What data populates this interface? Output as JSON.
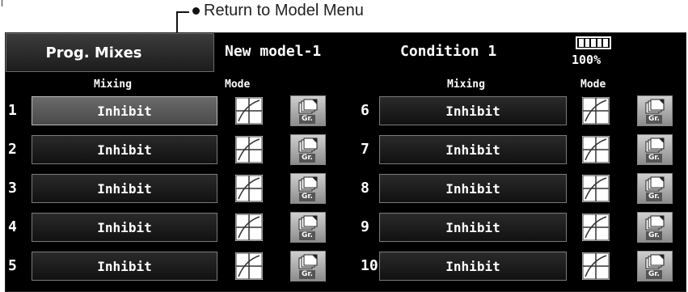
{
  "annotation": {
    "label": "Return to Model Menu"
  },
  "header": {
    "title": "Prog. Mixes",
    "model": "New model-1",
    "condition": "Condition 1",
    "battery_pct": "100%",
    "battery_level": 1.0
  },
  "columns": {
    "mixing": "Mixing",
    "mode": "Mode"
  },
  "mix_rows": [
    {
      "num": "1",
      "value": "Inhibit",
      "gr": "Gr.",
      "selected": true
    },
    {
      "num": "2",
      "value": "Inhibit",
      "gr": "Gr."
    },
    {
      "num": "3",
      "value": "Inhibit",
      "gr": "Gr."
    },
    {
      "num": "4",
      "value": "Inhibit",
      "gr": "Gr."
    },
    {
      "num": "5",
      "value": "Inhibit",
      "gr": "Gr."
    },
    {
      "num": "6",
      "value": "Inhibit",
      "gr": "Gr."
    },
    {
      "num": "7",
      "value": "Inhibit",
      "gr": "Gr."
    },
    {
      "num": "8",
      "value": "Inhibit",
      "gr": "Gr."
    },
    {
      "num": "9",
      "value": "Inhibit",
      "gr": "Gr."
    },
    {
      "num": "10",
      "value": "Inhibit",
      "gr": "Gr."
    }
  ],
  "icons": {
    "mode": "mixing-curve-icon",
    "group": "group-copy-icon",
    "battery": "battery-icon"
  }
}
